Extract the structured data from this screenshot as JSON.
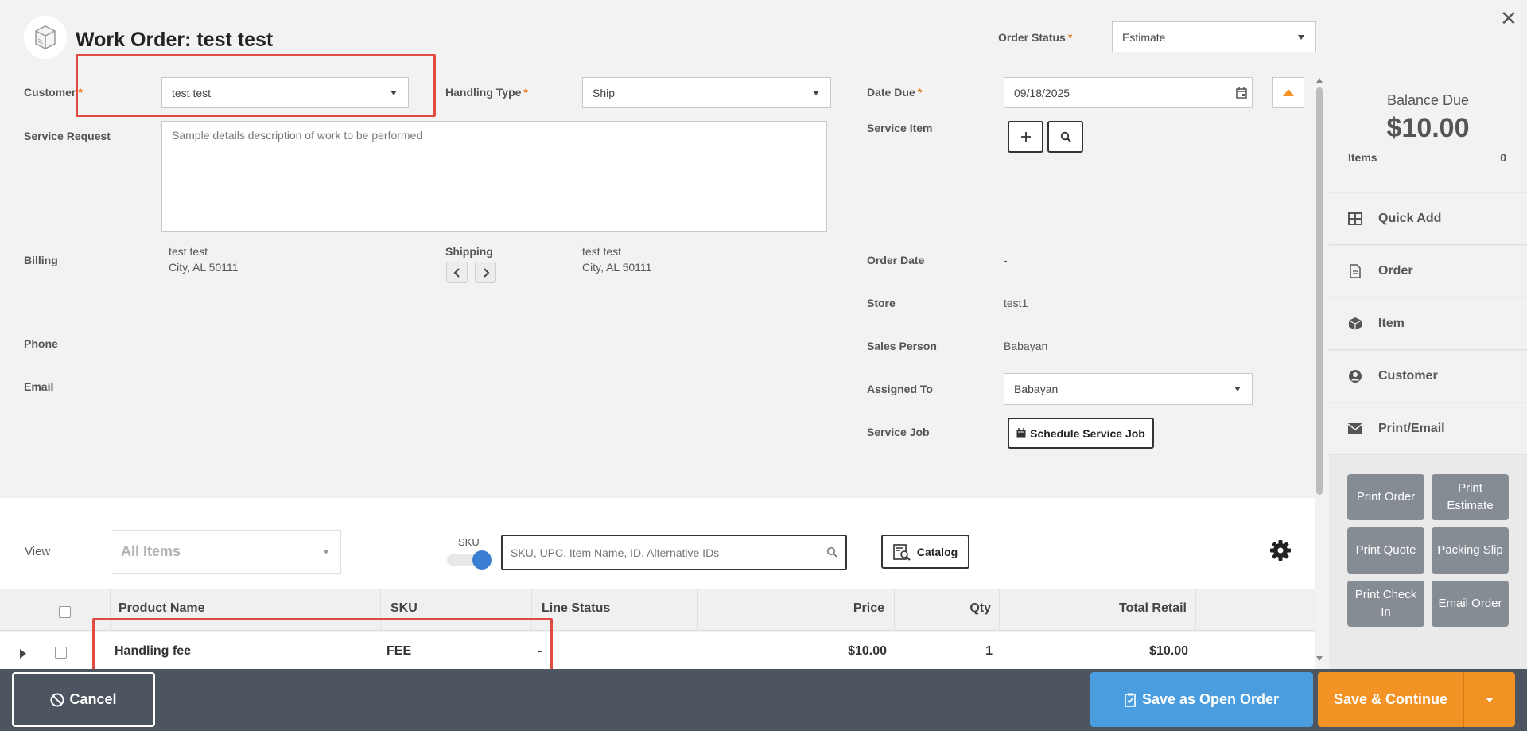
{
  "header": {
    "title": "Work Order: test test",
    "order_status_label": "Order Status",
    "order_status_value": "Estimate",
    "close_glyph": "✕"
  },
  "form": {
    "customer_label": "Customer",
    "customer_value": "test test",
    "handling_type_label": "Handling Type",
    "handling_type_value": "Ship",
    "date_due_label": "Date Due",
    "date_due_value": "09/18/2025",
    "service_request_label": "Service Request",
    "service_request_placeholder": "Sample details description of work to be performed",
    "service_item_label": "Service Item",
    "billing_label": "Billing",
    "billing_name": "test test",
    "billing_city": "City, AL 50111",
    "shipping_label": "Shipping",
    "shipping_name": "test test",
    "shipping_city": "City, AL 50111",
    "phone_label": "Phone",
    "email_label": "Email",
    "order_date_label": "Order Date",
    "order_date_value": "-",
    "store_label": "Store",
    "store_value": "test1",
    "sales_person_label": "Sales Person",
    "sales_person_value": "Babayan",
    "assigned_to_label": "Assigned To",
    "assigned_to_value": "Babayan",
    "service_job_label": "Service Job",
    "schedule_button": "Schedule Service Job"
  },
  "sidebar": {
    "balance_label": "Balance Due",
    "balance_value": "$10.00",
    "items_label": "Items",
    "items_count": "0",
    "menu": [
      {
        "label": "Quick Add",
        "icon": "grid-icon"
      },
      {
        "label": "Order",
        "icon": "document-icon"
      },
      {
        "label": "Item",
        "icon": "cube-icon"
      },
      {
        "label": "Customer",
        "icon": "user-circle-icon"
      },
      {
        "label": "Print/Email",
        "icon": "envelope-icon"
      }
    ],
    "print_buttons": [
      "Print Order",
      "Print Estimate",
      "Print Quote",
      "Packing Slip",
      "Print Check In",
      "Email Order"
    ]
  },
  "items_toolbar": {
    "view_label": "View",
    "view_value": "All Items",
    "sku_label": "SKU",
    "search_placeholder": "SKU, UPC, Item Name, ID, Alternative IDs",
    "catalog_button": "Catalog"
  },
  "table": {
    "columns": [
      "Product Name",
      "SKU",
      "Line Status",
      "Price",
      "Qty",
      "Total Retail"
    ],
    "rows": [
      {
        "product_name": "Handling fee",
        "sku": "FEE",
        "line_status": "-",
        "price": "$10.00",
        "qty": "1",
        "total_retail": "$10.00"
      }
    ]
  },
  "footer": {
    "cancel": "Cancel",
    "save_open": "Save as Open Order",
    "save_continue": "Save & Continue"
  },
  "colors": {
    "accent_orange": "#f39325",
    "save_blue": "#4a9ee0",
    "footer_bg": "#4d5660",
    "highlight_red": "#e04a3f"
  }
}
